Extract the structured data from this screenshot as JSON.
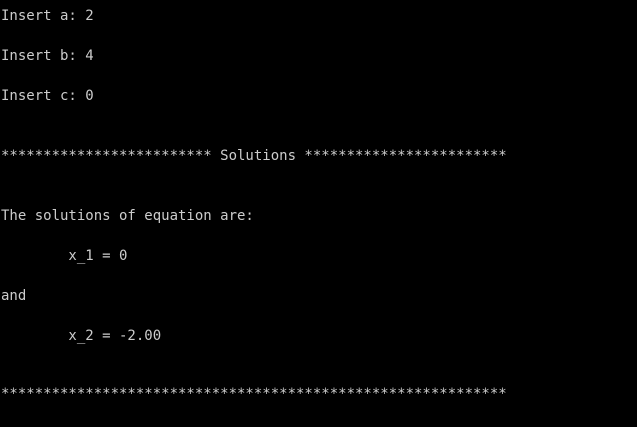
{
  "colors": {
    "background": "#000000",
    "text": "#cccccc"
  },
  "console": {
    "lines": [
      "Insert a: 2",
      "Insert b: 4",
      "Insert c: 0",
      "************************* Solutions ************************",
      "The solutions of equation are:",
      "        x_1 = 0",
      "and",
      "        x_2 = -2.00",
      "************************************************************"
    ]
  }
}
